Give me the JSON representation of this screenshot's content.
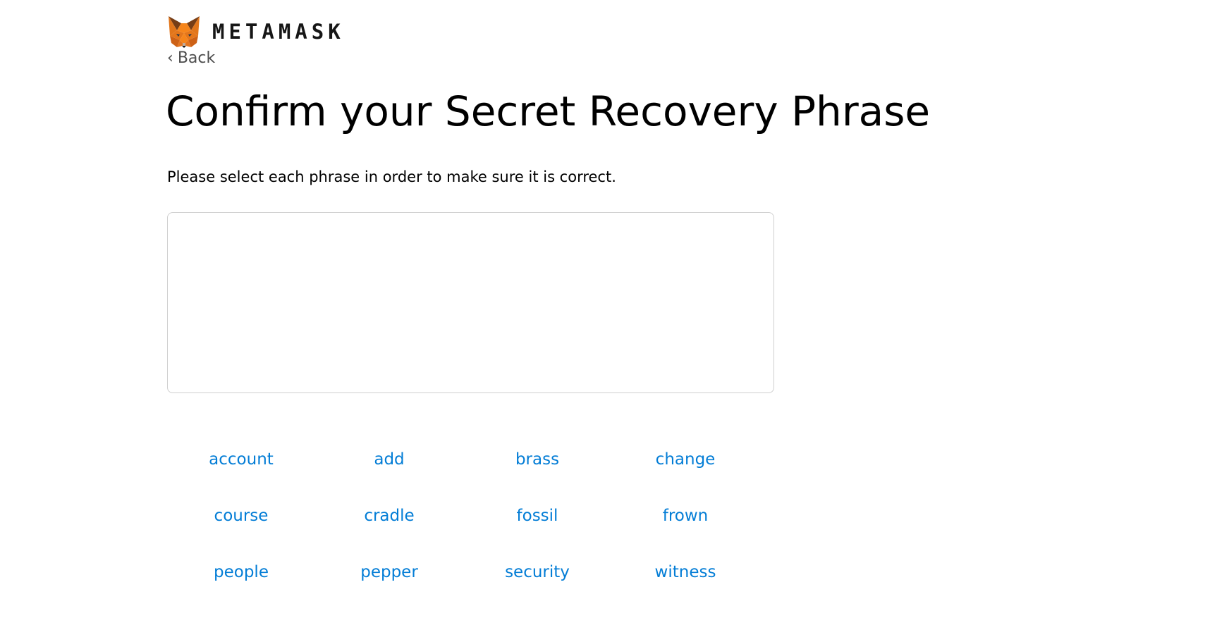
{
  "header": {
    "logo_icon": "metamask-fox-icon",
    "wordmark": "METAMASK"
  },
  "back": {
    "chevron": "‹",
    "label": "Back"
  },
  "title": "Confirm your Secret Recovery Phrase",
  "subtitle": "Please select each phrase in order to make sure it is correct.",
  "phrase_box": {
    "selected_words": []
  },
  "words": [
    "account",
    "add",
    "brass",
    "change",
    "course",
    "cradle",
    "fossil",
    "frown",
    "people",
    "pepper",
    "security",
    "witness"
  ],
  "colors": {
    "word_link": "#037dd6",
    "fox_orange": "#e2761b",
    "text_dark": "#000000"
  }
}
